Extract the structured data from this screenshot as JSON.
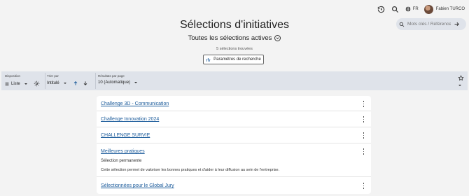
{
  "header": {
    "lang_code": "FR",
    "user_name": "Fabien TURCO",
    "icons": [
      "history-icon",
      "search-icon",
      "globe-icon"
    ]
  },
  "search": {
    "placeholder": "Mots clés / Référence"
  },
  "page": {
    "title": "Sélections d'initiatives",
    "selection_label": "Toutes les sélections actives",
    "results_count": "5 sélections trouvées",
    "params_button": "Paramètres de recherche"
  },
  "toolbar": {
    "layout_label": "Disposition",
    "layout_value": "Liste",
    "sort_label": "Trier par",
    "sort_value": "Intitulé",
    "perpage_label": "Résultats par page",
    "perpage_value": "10 (Automatique)"
  },
  "items": [
    {
      "title": "Challenge 3D - Communication"
    },
    {
      "title": "Challenge Innovation 2024"
    },
    {
      "title": "CHALLENGE SURVIE"
    },
    {
      "title": "Meilleures pratiques",
      "subtitle": "Sélection permanente",
      "description": "Cette sélection permet de valoriser les bonnes pratiques et d'aider à leur diffusion au sein de l'entreprise."
    },
    {
      "title": "Sélectionnées pour le Global Jury"
    }
  ],
  "colors": {
    "background": "#f3f3f3",
    "toolbar": "#dfe3ea",
    "link": "#1a5a9a",
    "sort_arrow": "#1a5a9a"
  }
}
